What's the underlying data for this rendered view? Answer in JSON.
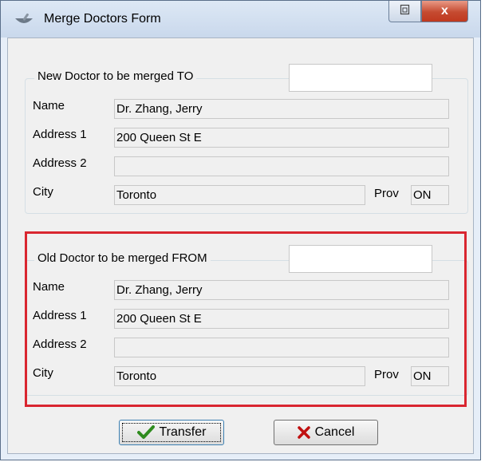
{
  "window": {
    "title": "Merge Doctors Form",
    "close_glyph": "x",
    "restore_icon": "restore-icon",
    "app_icon": "mortar-pestle-icon"
  },
  "new_doctor": {
    "legend": "New Doctor to be merged TO",
    "search_value": "",
    "labels": {
      "name": "Name",
      "address1": "Address 1",
      "address2": "Address 2",
      "city": "City",
      "prov": "Prov"
    },
    "name": "Dr. Zhang, Jerry",
    "address1": "200 Queen St E",
    "address2": "",
    "city": "Toronto",
    "prov": "ON"
  },
  "old_doctor": {
    "legend": "Old Doctor to be merged FROM",
    "search_value": "",
    "labels": {
      "name": "Name",
      "address1": "Address 1",
      "address2": "Address 2",
      "city": "City",
      "prov": "Prov"
    },
    "name": "Dr. Zhang, Jerry",
    "address1": "200 Queen St E",
    "address2": "",
    "city": "Toronto",
    "prov": "ON"
  },
  "buttons": {
    "transfer": "Transfer",
    "cancel": "Cancel",
    "transfer_icon": "checkmark-icon",
    "cancel_icon": "x-icon"
  },
  "colors": {
    "highlight_border": "#d92630",
    "check_green": "#2e8b1e",
    "cancel_red": "#c01010"
  }
}
